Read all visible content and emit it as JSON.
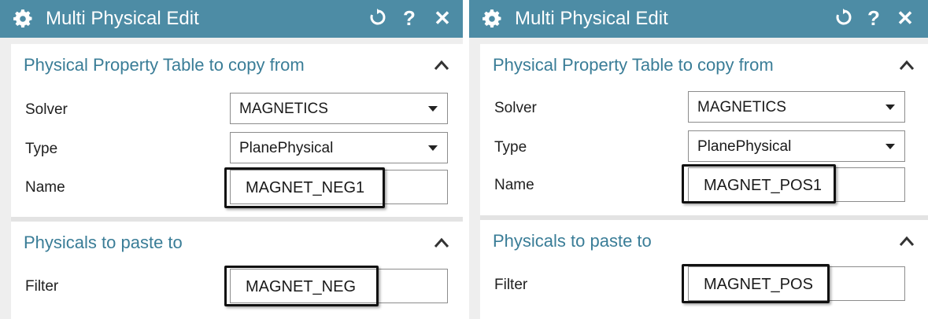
{
  "dialogs": [
    {
      "title": "Multi Physical Edit",
      "section1": {
        "title": "Physical Property Table to copy from",
        "solver_label": "Solver",
        "solver_value": "MAGNETICS",
        "type_label": "Type",
        "type_value": "PlanePhysical",
        "name_label": "Name",
        "name_value": "MAGNET_NEG1"
      },
      "section2": {
        "title": "Physicals to paste to",
        "filter_label": "Filter",
        "filter_value": "MAGNET_NEG"
      }
    },
    {
      "title": "Multi Physical Edit",
      "section1": {
        "title": "Physical Property Table to copy from",
        "solver_label": "Solver",
        "solver_value": "MAGNETICS",
        "type_label": "Type",
        "type_value": "PlanePhysical",
        "name_label": "Name",
        "name_value": "MAGNET_POS1"
      },
      "section2": {
        "title": "Physicals to paste to",
        "filter_label": "Filter",
        "filter_value": "MAGNET_POS"
      }
    }
  ],
  "icons": {
    "settings": "gear-icon",
    "reset": "reset-icon",
    "help": "help-icon",
    "close": "close-icon",
    "collapse": "chevron-up-icon",
    "dropdown": "chevron-down-icon"
  },
  "colors": {
    "titlebar": "#4d8ca5",
    "section_title": "#3a7d97",
    "highlight_border": "#111111"
  },
  "glyphs": {
    "help": "?",
    "close": "✕"
  }
}
